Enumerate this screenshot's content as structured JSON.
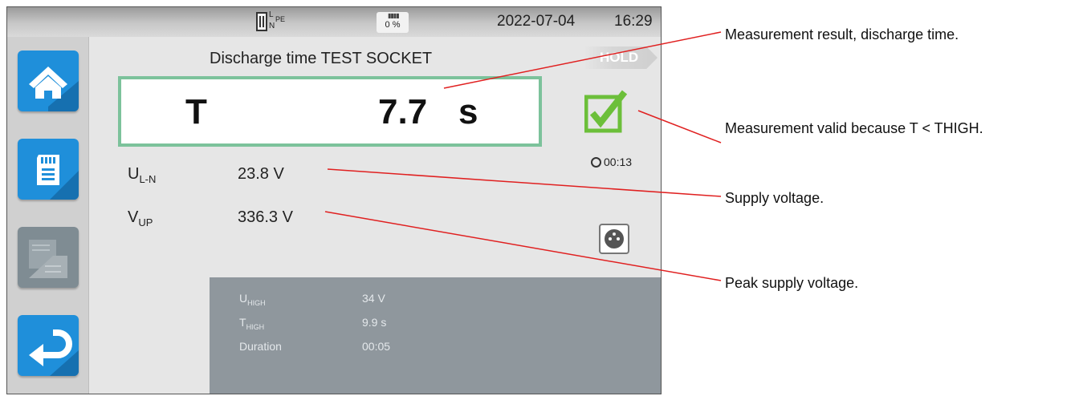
{
  "status_bar": {
    "connection_labels": {
      "l": "L",
      "n": "N",
      "pe": "PE"
    },
    "sd_card_fill": "0 %",
    "date": "2022-07-04",
    "time": "16:29"
  },
  "sidebar": {
    "buttons": [
      {
        "name": "home",
        "icon": "home-icon"
      },
      {
        "name": "memory",
        "icon": "sd-card-icon"
      },
      {
        "name": "tabs",
        "icon": "tabs-icon",
        "state": "disabled"
      },
      {
        "name": "back",
        "icon": "return-arrow-icon"
      }
    ]
  },
  "screen": {
    "title": "Discharge time TEST SOCKET",
    "hold_label": "HOLD",
    "result": {
      "symbol": "T",
      "value": "7.7",
      "unit": "s"
    },
    "valid_icon": "check-icon",
    "timer": "00:13",
    "measurements": [
      {
        "symbol": "U",
        "sub": "L-N",
        "value": "23.8 V"
      },
      {
        "symbol": "V",
        "sub": "UP",
        "value": "336.3 V"
      }
    ],
    "socket_icon": "test-socket-icon",
    "limits": [
      {
        "label": "U",
        "sub": "HIGH",
        "value": "34 V"
      },
      {
        "label": "T",
        "sub": "HIGH",
        "value": "9.9 s"
      },
      {
        "label": "Duration",
        "sub": "",
        "value": "00:05"
      }
    ]
  },
  "callouts": [
    "Measurement result, discharge time.",
    "Measurement valid because T < THIGH.",
    "Supply voltage.",
    "Peak supply voltage."
  ],
  "colors": {
    "accent_blue": "#1f8fda",
    "valid_green": "#6cbf3a",
    "result_border": "#7cc29b",
    "callout_line": "#e02020",
    "limits_panel": "#8f979d"
  }
}
